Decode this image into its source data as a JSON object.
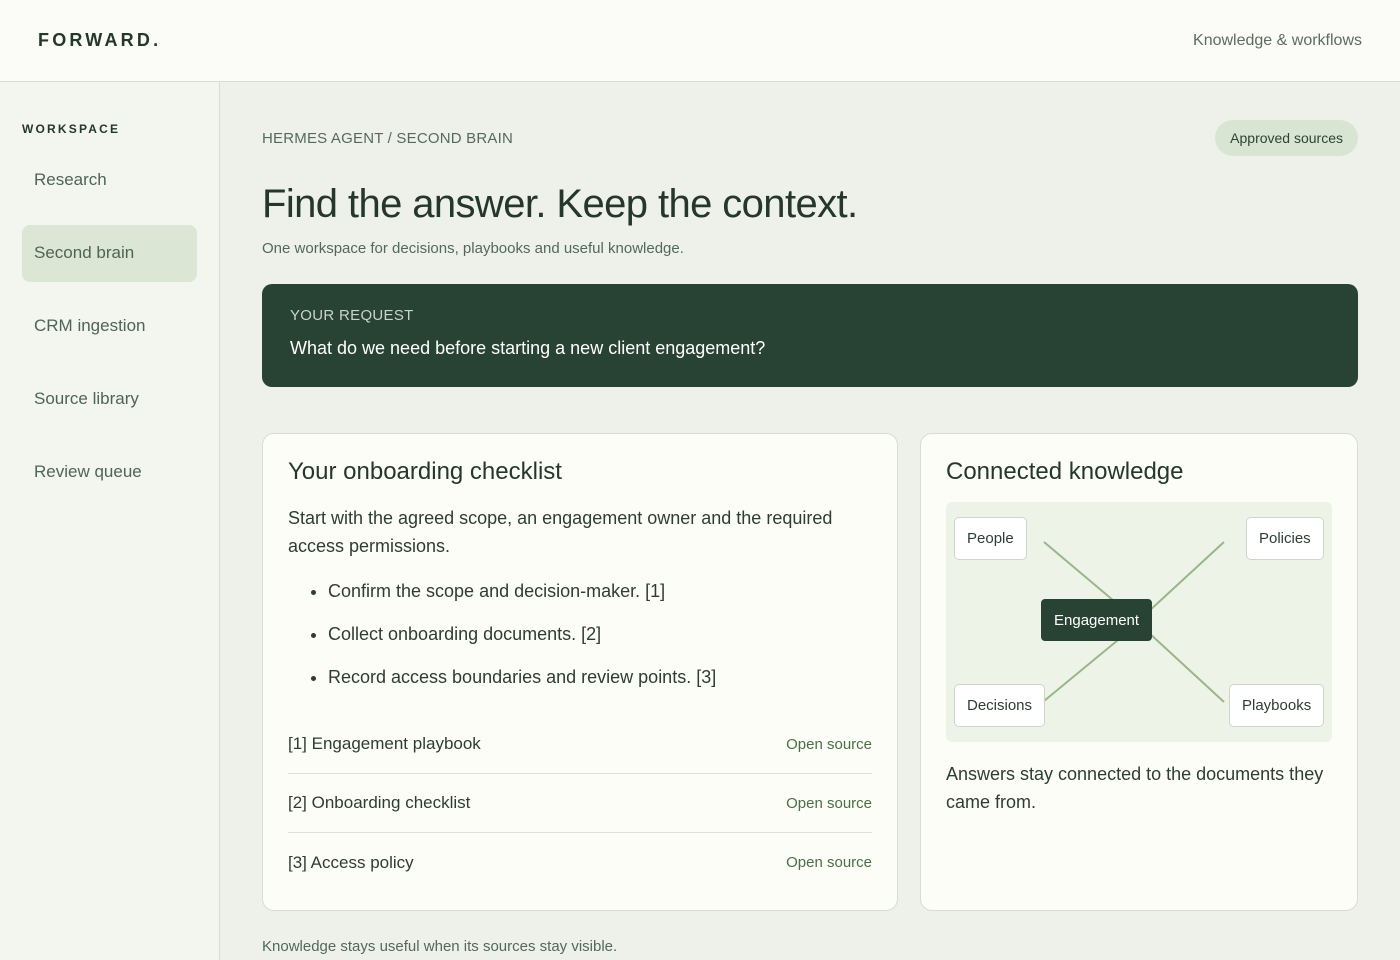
{
  "app": {
    "logo": "FORWARD.",
    "tagline": "Knowledge & workflows"
  },
  "sidebar": {
    "title": "WORKSPACE",
    "items": [
      {
        "label": "Research",
        "active": false
      },
      {
        "label": "Second brain",
        "active": true
      },
      {
        "label": "CRM ingestion",
        "active": false
      },
      {
        "label": "Source library",
        "active": false
      },
      {
        "label": "Review queue",
        "active": false
      }
    ]
  },
  "header": {
    "breadcrumb": "HERMES AGENT / SECOND BRAIN",
    "badge": "Approved sources",
    "title": "Find the answer. Keep the context.",
    "subtitle": "One workspace for decisions, playbooks and useful knowledge."
  },
  "request": {
    "label": "YOUR REQUEST",
    "text": "What do we need before starting a new client engagement?"
  },
  "checklist": {
    "title": "Your onboarding checklist",
    "intro": "Start with the agreed scope, an engagement owner and the required access permissions.",
    "items": [
      "Confirm the scope and decision-maker. [1]",
      "Collect onboarding documents. [2]",
      "Record access boundaries and review points. [3]"
    ],
    "sources": [
      {
        "name": "[1] Engagement playbook",
        "link": "Open source"
      },
      {
        "name": "[2] Onboarding checklist",
        "link": "Open source"
      },
      {
        "name": "[3] Access policy",
        "link": "Open source"
      }
    ]
  },
  "knowledge": {
    "title": "Connected knowledge",
    "nodes": {
      "center": "Engagement",
      "top_left": "People",
      "top_right": "Policies",
      "bottom_left": "Decisions",
      "bottom_right": "Playbooks"
    },
    "caption": "Answers stay connected to the documents they came from.",
    "line_color": "#9ab58a"
  },
  "footer": {
    "note": "Knowledge stays useful when its sources stay visible."
  },
  "colors": {
    "accent_dark": "#284334",
    "active_nav": "#dce6d5",
    "badge_bg": "#d9e5d3",
    "link": "#4a6e45"
  }
}
